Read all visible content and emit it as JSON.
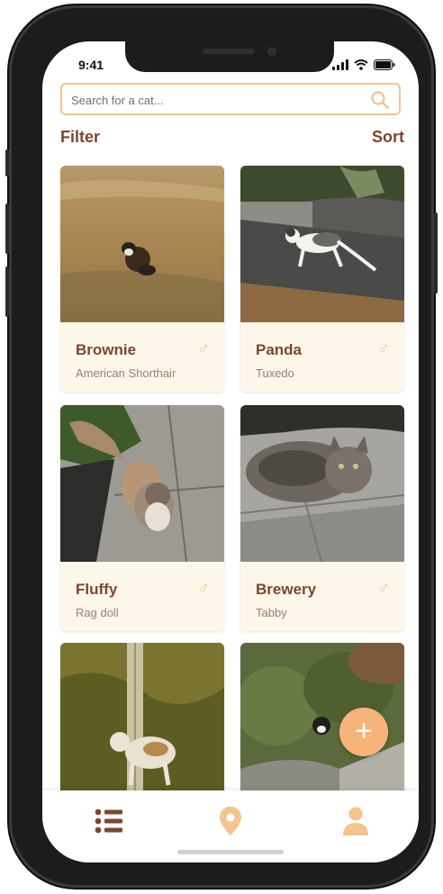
{
  "status": {
    "time": "9:41"
  },
  "search": {
    "placeholder": "Search for a cat..."
  },
  "toolbar": {
    "filter_label": "Filter",
    "sort_label": "Sort"
  },
  "cats": [
    {
      "name": "Brownie",
      "breed": "American Shorthair",
      "sex_icon": "male-icon"
    },
    {
      "name": "Panda",
      "breed": "Tuxedo",
      "sex_icon": "male-icon"
    },
    {
      "name": "Fluffy",
      "breed": "Rag doll",
      "sex_icon": "male-icon"
    },
    {
      "name": "Brewery",
      "breed": "Tabby",
      "sex_icon": "male-icon"
    },
    {
      "name": "",
      "breed": "",
      "sex_icon": ""
    },
    {
      "name": "",
      "breed": "",
      "sex_icon": ""
    }
  ],
  "fab": {
    "label": "+"
  },
  "nav": {
    "items": [
      "list-icon",
      "map-pin-icon",
      "profile-icon"
    ]
  },
  "colors": {
    "accent": "#f3c48f",
    "title": "#7a4632",
    "card_bg": "#fdf7ea",
    "fab": "#f7b47a"
  }
}
